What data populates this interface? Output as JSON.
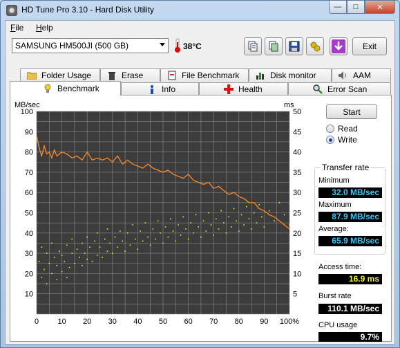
{
  "window": {
    "title": "HD Tune Pro 3.10 - Hard Disk Utility"
  },
  "menu": [
    {
      "label": "File",
      "u": "F",
      "rest": "ile"
    },
    {
      "label": "Help",
      "u": "H",
      "rest": "elp"
    }
  ],
  "toolbar": {
    "drive": "SAMSUNG HM500JI (500 GB)",
    "temperature": "38°C",
    "exit_label": "Exit"
  },
  "tabs_top": [
    "Folder Usage",
    "Erase",
    "File Benchmark",
    "Disk monitor",
    "AAM"
  ],
  "tabs_bottom": [
    "Benchmark",
    "Info",
    "Health",
    "Error Scan"
  ],
  "controls": {
    "start_label": "Start",
    "read_label": "Read",
    "write_label": "Write",
    "selected": "Write"
  },
  "transfer": {
    "group_label": "Transfer rate",
    "minimum_label": "Minimum",
    "minimum": "32.0 MB/sec",
    "maximum_label": "Maximum",
    "maximum": "87.9 MB/sec",
    "average_label": "Average:",
    "average": "65.9 MB/sec"
  },
  "access": {
    "label": "Access time:",
    "value": "16.9 ms"
  },
  "burst": {
    "label": "Burst rate",
    "value": "110.1 MB/sec"
  },
  "cpu": {
    "label": "CPU usage",
    "value": "9.7%"
  },
  "colors": {
    "accent_blue": "#3ec3f2",
    "accent_yellow": "#f1f02a",
    "line_orange": "#ff8a2a",
    "plot_bg": "#3c3c3c"
  },
  "chart_data": {
    "type": "line",
    "left_axis_label": "MB/sec",
    "right_axis_label": "ms",
    "ylim_left": [
      0,
      100
    ],
    "ylim_right": [
      0,
      50
    ],
    "y_ticks_left": [
      "100",
      "90",
      "80",
      "70",
      "60",
      "50",
      "40",
      "30",
      "20",
      "10"
    ],
    "y_ticks_right": [
      "50",
      "45",
      "40",
      "35",
      "30",
      "25",
      "20",
      "15",
      "10",
      "5"
    ],
    "x_ticks": [
      "0",
      "10",
      "20",
      "30",
      "40",
      "50",
      "60",
      "70",
      "80",
      "90",
      "100%"
    ],
    "grid": true,
    "series": [
      {
        "kind": "line",
        "x": [
          0,
          1,
          2,
          3,
          4,
          5,
          6,
          7,
          8,
          9,
          10,
          12,
          14,
          16,
          18,
          20,
          22,
          24,
          26,
          28,
          30,
          32,
          34,
          36,
          38,
          40,
          42,
          44,
          46,
          48,
          50,
          52,
          54,
          56,
          58,
          60,
          62,
          64,
          66,
          68,
          70,
          72,
          74,
          76,
          78,
          80,
          82,
          84,
          86,
          88,
          90,
          92,
          94,
          96,
          98,
          100
        ],
        "y": [
          87.9,
          82,
          78,
          83,
          79,
          80,
          77,
          81,
          78,
          79,
          80,
          79,
          77,
          78,
          76,
          80,
          76,
          77,
          76,
          77,
          75,
          78,
          74,
          76,
          74,
          73,
          72,
          74,
          72,
          71,
          70,
          71,
          69,
          68,
          67,
          69,
          66,
          65,
          64,
          65,
          62,
          63,
          61,
          59,
          60,
          58,
          57,
          55,
          55,
          52,
          51,
          49,
          48,
          46,
          44,
          42
        ]
      },
      {
        "kind": "scatter",
        "points": [
          [
            1,
            26
          ],
          [
            2,
            18
          ],
          [
            2,
            33
          ],
          [
            3,
            22
          ],
          [
            4,
            30
          ],
          [
            4,
            15
          ],
          [
            5,
            25
          ],
          [
            6,
            20
          ],
          [
            6,
            35
          ],
          [
            7,
            28
          ],
          [
            8,
            17
          ],
          [
            8,
            24
          ],
          [
            9,
            31
          ],
          [
            10,
            21
          ],
          [
            10,
            29
          ],
          [
            11,
            26
          ],
          [
            12,
            34
          ],
          [
            12,
            18
          ],
          [
            13,
            23
          ],
          [
            14,
            30
          ],
          [
            14,
            37
          ],
          [
            15,
            25
          ],
          [
            16,
            32
          ],
          [
            17,
            28
          ],
          [
            18,
            35
          ],
          [
            18,
            24
          ],
          [
            19,
            30
          ],
          [
            20,
            27
          ],
          [
            20,
            38
          ],
          [
            21,
            33
          ],
          [
            22,
            26
          ],
          [
            23,
            36
          ],
          [
            24,
            29
          ],
          [
            24,
            40
          ],
          [
            25,
            33
          ],
          [
            26,
            28
          ],
          [
            27,
            37
          ],
          [
            28,
            31
          ],
          [
            28,
            42
          ],
          [
            29,
            35
          ],
          [
            30,
            30
          ],
          [
            31,
            38
          ],
          [
            32,
            33
          ],
          [
            33,
            41
          ],
          [
            34,
            36
          ],
          [
            35,
            31
          ],
          [
            36,
            40
          ],
          [
            37,
            34
          ],
          [
            38,
            44
          ],
          [
            39,
            37
          ],
          [
            40,
            32
          ],
          [
            41,
            41
          ],
          [
            42,
            36
          ],
          [
            43,
            45
          ],
          [
            44,
            38
          ],
          [
            45,
            34
          ],
          [
            46,
            42
          ],
          [
            47,
            37
          ],
          [
            48,
            46
          ],
          [
            49,
            40
          ],
          [
            50,
            35
          ],
          [
            51,
            43
          ],
          [
            52,
            38
          ],
          [
            53,
            47
          ],
          [
            54,
            41
          ],
          [
            55,
            36
          ],
          [
            56,
            44
          ],
          [
            57,
            39
          ],
          [
            58,
            48
          ],
          [
            59,
            42
          ],
          [
            60,
            37
          ],
          [
            61,
            45
          ],
          [
            62,
            40
          ],
          [
            63,
            49
          ],
          [
            64,
            43
          ],
          [
            65,
            38
          ],
          [
            66,
            46
          ],
          [
            67,
            41
          ],
          [
            68,
            50
          ],
          [
            69,
            44
          ],
          [
            70,
            39
          ],
          [
            71,
            47
          ],
          [
            72,
            42
          ],
          [
            73,
            51
          ],
          [
            74,
            45
          ],
          [
            75,
            40
          ],
          [
            76,
            48
          ],
          [
            77,
            43
          ],
          [
            78,
            52
          ],
          [
            79,
            46
          ],
          [
            80,
            41
          ],
          [
            81,
            49
          ],
          [
            82,
            44
          ],
          [
            83,
            53
          ],
          [
            84,
            47
          ],
          [
            85,
            42
          ],
          [
            86,
            50
          ],
          [
            87,
            45
          ],
          [
            88,
            54
          ],
          [
            89,
            48
          ],
          [
            90,
            43
          ],
          [
            92,
            51
          ],
          [
            94,
            46
          ],
          [
            96,
            55
          ],
          [
            98,
            49
          ],
          [
            100,
            44
          ]
        ]
      }
    ]
  }
}
